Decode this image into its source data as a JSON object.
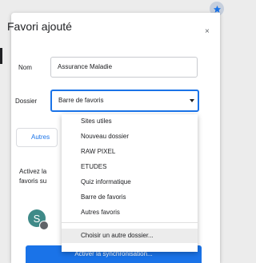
{
  "dialog": {
    "title": "Favori ajouté",
    "name_label": "Nom",
    "name_value": "Assurance Maladie",
    "folder_label": "Dossier",
    "folder_value": "Barre de favoris",
    "partial_button": "Autres",
    "sync_text": "Activez la favoris su",
    "avatar_initial": "S",
    "sync_button": "Activer la synchronisation..."
  },
  "dropdown": {
    "items": [
      "Sites utiles",
      "Nouveau dossier",
      "RAW PIXEL",
      "ETUDES",
      "Quiz informatique",
      "Barre de favoris",
      "Autres favoris"
    ],
    "choose_other": "Choisir un autre dossier..."
  },
  "colors": {
    "accent": "#1a73e8",
    "avatar": "#3f8a88"
  }
}
